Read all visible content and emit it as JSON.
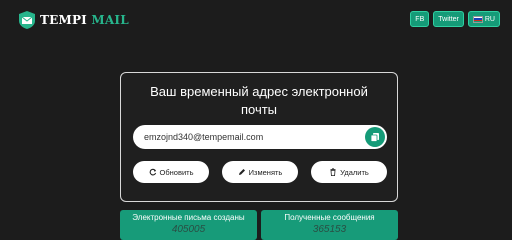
{
  "header": {
    "logo_part1": "TEMPI",
    "logo_part2": "MAIL",
    "nav": [
      {
        "label": "FB"
      },
      {
        "label": "Twitter"
      },
      {
        "label": "RU",
        "icon": "russia-flag-icon"
      }
    ]
  },
  "card": {
    "title": "Ваш временный адрес электронной почты",
    "email": "emzojnd340@tempemail.com",
    "copy_icon": "copy-icon",
    "actions": [
      {
        "label": "Обновить",
        "icon": "refresh-icon"
      },
      {
        "label": "Изменять",
        "icon": "pencil-icon"
      },
      {
        "label": "Удалить",
        "icon": "trash-icon"
      }
    ]
  },
  "stats": [
    {
      "label": "Электронные письма созданы",
      "value": "405005"
    },
    {
      "label": "Полученные сообщения",
      "value": "365153"
    }
  ],
  "colors": {
    "accent": "#159b78",
    "background": "#1c1c1c"
  }
}
